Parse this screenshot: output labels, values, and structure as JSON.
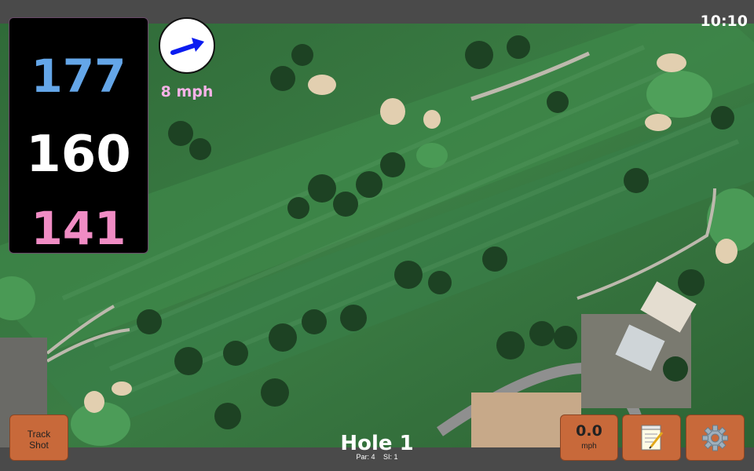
{
  "status": {
    "time": "10:10"
  },
  "yardage": {
    "back": "177",
    "middle": "160",
    "front": "141"
  },
  "wind": {
    "speed": "8 mph",
    "icon": "wind-direction-arrow-icon"
  },
  "hole": {
    "title": "Hole 1",
    "par": "Par: 4",
    "si": "SI: 1"
  },
  "buttons": {
    "track_line1": "Track",
    "track_line2": "Shot",
    "speed_value": "0.0",
    "speed_unit": "mph",
    "notes_icon": "notepad-icon",
    "settings_icon": "gear-icon"
  },
  "colors": {
    "back_yardage": "#64a6e8",
    "middle_yardage": "#ffffff",
    "front_yardage": "#f08cc4",
    "button": "#c8693a",
    "wind_speed_text": "#f7b3e8"
  }
}
